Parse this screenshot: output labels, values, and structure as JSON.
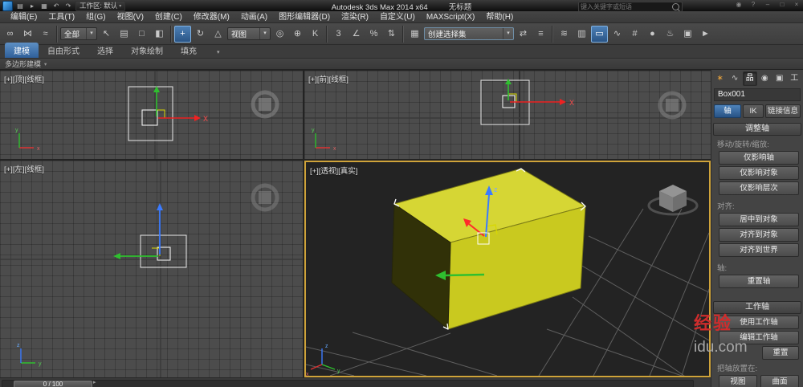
{
  "glyphs": {
    "caret": "▾",
    "nub": "▸",
    "minimize": "–",
    "maximize": "□",
    "close": "×"
  },
  "titlebar": {
    "app_title": "Autodesk 3ds Max  2014 x64",
    "doc_title": "无标题",
    "workspace_label": "工作区: 默认",
    "search_placeholder": "键入关键字或短语",
    "quick_icons": [
      {
        "name": "new-scene-icon",
        "glyph": "▤"
      },
      {
        "name": "open-file-icon",
        "glyph": "▸"
      },
      {
        "name": "save-file-icon",
        "glyph": "▦"
      },
      {
        "name": "undo-icon",
        "glyph": "↶"
      },
      {
        "name": "redo-icon",
        "glyph": "↷"
      }
    ],
    "right_icons": [
      {
        "name": "help-icon",
        "glyph": "?"
      },
      {
        "name": "sign-in-icon",
        "glyph": "◉"
      }
    ]
  },
  "menubar": {
    "items": [
      "编辑(E)",
      "工具(T)",
      "组(G)",
      "视图(V)",
      "创建(C)",
      "修改器(M)",
      "动画(A)",
      "图形编辑器(D)",
      "渲染(R)",
      "自定义(U)",
      "MAXScript(X)",
      "帮助(H)"
    ]
  },
  "toolbar": {
    "selection_filter": "全部",
    "coord_system": "视图",
    "named_selection": "创建选择集",
    "icons": [
      {
        "name": "select-and-link-icon",
        "glyph": "∞"
      },
      {
        "name": "unlink-selection-icon",
        "glyph": "⋈"
      },
      {
        "name": "bind-to-space-warp-icon",
        "glyph": "≈"
      },
      {
        "name": "select-object-icon",
        "glyph": "↖"
      },
      {
        "name": "select-by-name-icon",
        "glyph": "▤"
      },
      {
        "name": "rectangular-selection-region-icon",
        "glyph": "□"
      },
      {
        "name": "window-crossing-icon",
        "glyph": "◧"
      },
      {
        "name": "select-and-move-icon",
        "glyph": "+",
        "active": true
      },
      {
        "name": "select-and-rotate-icon",
        "glyph": "↻"
      },
      {
        "name": "select-and-scale-icon",
        "glyph": "△"
      },
      {
        "name": "use-pivot-point-center-icon",
        "glyph": "◎"
      },
      {
        "name": "select-and-manipulate-icon",
        "glyph": "⊕"
      },
      {
        "name": "keyboard-override-icon",
        "glyph": "K"
      },
      {
        "name": "snap-toggle-icon",
        "glyph": "3"
      },
      {
        "name": "angle-snap-icon",
        "glyph": "∠"
      },
      {
        "name": "percent-snap-icon",
        "glyph": "%"
      },
      {
        "name": "spinner-snap-icon",
        "glyph": "⇅"
      },
      {
        "name": "edit-named-selection-sets-icon",
        "glyph": "▦"
      },
      {
        "name": "mirror-icon",
        "glyph": "⇄"
      },
      {
        "name": "align-icon",
        "glyph": "≡"
      },
      {
        "name": "layer-manager-icon",
        "glyph": "≋"
      },
      {
        "name": "layer-explorer-icon",
        "glyph": "▥"
      },
      {
        "name": "graphite-ribbon-toggle-icon",
        "glyph": "▭",
        "active": true
      },
      {
        "name": "curve-editor-icon",
        "glyph": "∿"
      },
      {
        "name": "schematic-view-icon",
        "glyph": "#"
      },
      {
        "name": "material-editor-icon",
        "glyph": "●"
      },
      {
        "name": "render-setup-icon",
        "glyph": "♨"
      },
      {
        "name": "rendered-frame-window-icon",
        "glyph": "▣"
      },
      {
        "name": "render-production-icon",
        "glyph": "►"
      }
    ]
  },
  "ribbon": {
    "tabs": [
      {
        "label": "建模",
        "active": true
      },
      {
        "label": "自由形式",
        "active": false
      },
      {
        "label": "选择",
        "active": false
      },
      {
        "label": "对象绘制",
        "active": false
      },
      {
        "label": "填充",
        "active": false
      }
    ],
    "panel_label": "多边形建模"
  },
  "viewports": {
    "top": {
      "label": "[+][顶][线框]"
    },
    "front": {
      "label": "[+][前][线框]"
    },
    "left": {
      "label": "[+][左][线框]"
    },
    "persp": {
      "label": "[+][透视][真实]"
    }
  },
  "axes": {
    "x": "x",
    "y": "y",
    "z": "z",
    "X": "X",
    "Z": "z"
  },
  "command_panel": {
    "tabs": [
      {
        "name": "create-tab",
        "glyph": "∗"
      },
      {
        "name": "modify-tab",
        "glyph": "∿"
      },
      {
        "name": "hierarchy-tab",
        "glyph": "品",
        "active": true
      },
      {
        "name": "motion-tab",
        "glyph": "◉"
      },
      {
        "name": "display-tab",
        "glyph": "▣"
      },
      {
        "name": "utilities-tab",
        "glyph": "工"
      }
    ],
    "object_name": "Box001",
    "subtabs": [
      {
        "label": "轴",
        "active": true
      },
      {
        "label": "IK",
        "active": false
      },
      {
        "label": "链接信息",
        "active": false
      }
    ],
    "rollout_adjust": "调整轴",
    "move_rotate_scale_label": "移动/旋转/缩放:",
    "affect_buttons": [
      "仅影响轴",
      "仅影响对象",
      "仅影响层次"
    ],
    "align_label": "对齐:",
    "align_buttons": [
      "居中到对象",
      "对齐到对象",
      "对齐到世界"
    ],
    "pivot_label": "轴:",
    "reset_pivot_button": "重置轴",
    "rollout_working": "工作轴",
    "working_buttons": [
      "使用工作轴",
      "编辑工作轴"
    ],
    "reset_button": "重置",
    "place_label": "把轴放置在:",
    "place_buttons": [
      "视图",
      "曲面"
    ]
  },
  "timeline": {
    "frame_value": "0 / 100"
  },
  "watermark": {
    "line1": "经验",
    "line2": "idu.com"
  }
}
